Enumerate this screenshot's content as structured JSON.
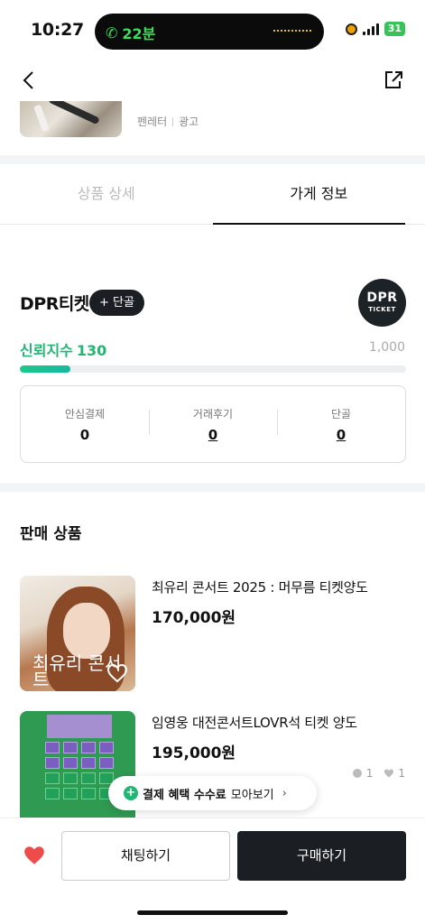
{
  "status_bar": {
    "time": "10:27",
    "call_duration": "22분",
    "battery": "31"
  },
  "ad": {
    "advertiser": "펜레터",
    "label": "광고"
  },
  "tabs": [
    {
      "label": "상품 상세",
      "active": false
    },
    {
      "label": "가게 정보",
      "active": true
    }
  ],
  "store": {
    "name": "DPR티켓",
    "follow_label": "+ 단골",
    "logo_line1": "DPR",
    "logo_line2": "TICKET",
    "trust_label": "신뢰지수",
    "trust_score": "130",
    "trust_max": "1,000",
    "trust_fraction": 0.13,
    "stats": [
      {
        "label": "안심결제",
        "value": "0"
      },
      {
        "label": "거래후기",
        "value": "0"
      },
      {
        "label": "단골",
        "value": "0"
      }
    ]
  },
  "products_section": {
    "title": "판매 상품",
    "items": [
      {
        "name": "최유리 콘서트 2025 : 머무름 티켓양도",
        "price": "170,000원",
        "image_text": "최유리 콘서트"
      },
      {
        "name": "임영웅 대전콘서트LOVR석 티켓 양도",
        "price": "195,000원",
        "chats": "1",
        "likes": "1"
      }
    ]
  },
  "banner": {
    "bold": "결제 혜택 수수료",
    "rest": "모아보기",
    "chevron": "›"
  },
  "bottom_bar": {
    "chat_label": "채팅하기",
    "buy_label": "구매하기"
  },
  "colors": {
    "accent_green": "#22b573",
    "dark_button": "#1b1f24",
    "heart_red": "#ee4b4b"
  }
}
